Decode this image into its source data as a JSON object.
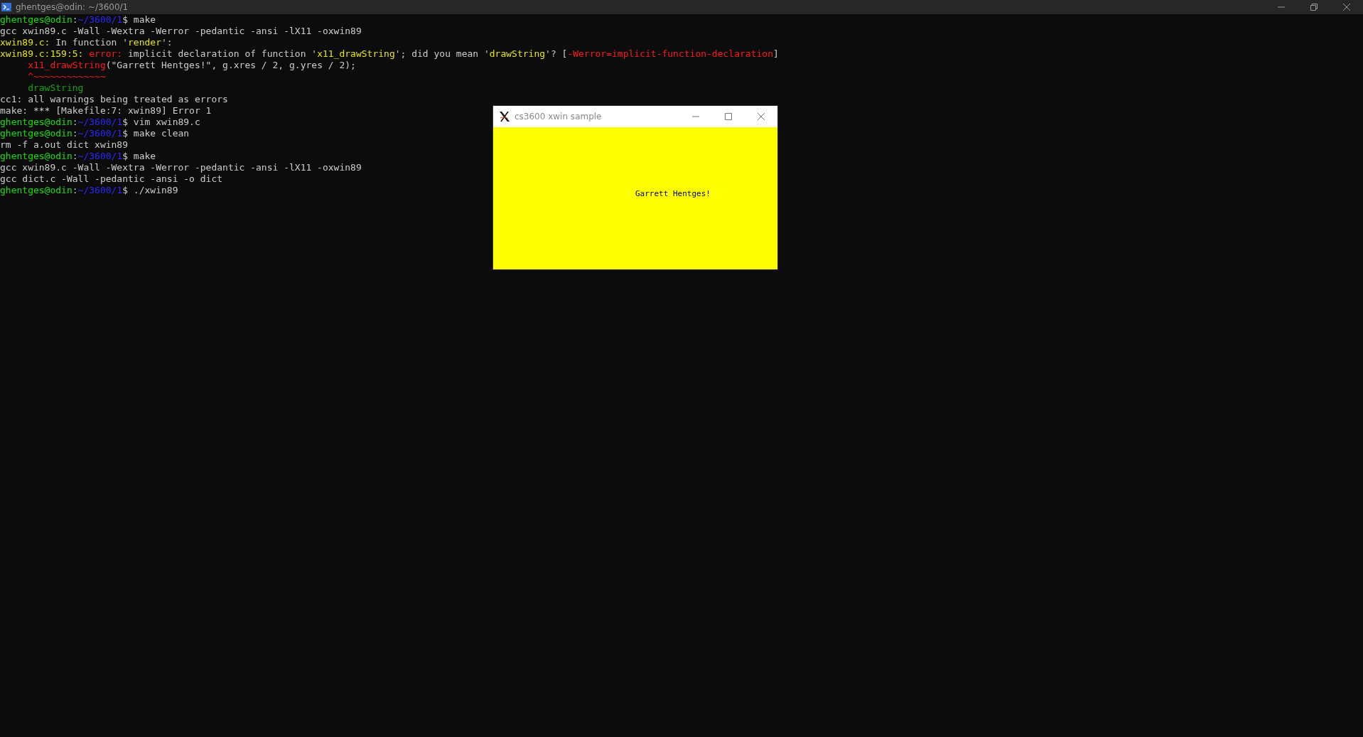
{
  "window": {
    "title": "ghentges@odin: ~/3600/1"
  },
  "terminal": {
    "lines": [
      [
        {
          "text": "ghentges@odin",
          "color": "#16e00c"
        },
        {
          "text": ":"
        },
        {
          "text": "~/3600/1",
          "color": "#2a2aff"
        },
        {
          "text": "$ make"
        }
      ],
      [
        {
          "text": "gcc xwin89.c -Wall -Wextra -Werror -pedantic -ansi -lX11 -oxwin89"
        }
      ],
      [
        {
          "text": "xwin89.c:",
          "color": "#e5e510"
        },
        {
          "text": " In function '"
        },
        {
          "text": "render",
          "color": "#e5e510"
        },
        {
          "text": "':"
        }
      ],
      [
        {
          "text": "xwin89.c:159:5:",
          "color": "#e5e510"
        },
        {
          "text": " error:",
          "color": "#ff1a1a"
        },
        {
          "text": " implicit declaration of function '"
        },
        {
          "text": "x11_drawString",
          "color": "#e5e510"
        },
        {
          "text": "'; did you mean '"
        },
        {
          "text": "drawString",
          "color": "#e5e510"
        },
        {
          "text": "'? ["
        },
        {
          "text": "-Werror=implicit-function-declaration",
          "color": "#ff1a1a"
        },
        {
          "text": "]"
        }
      ],
      [
        {
          "text": "     x11_drawString",
          "color": "#ff1a1a"
        },
        {
          "text": "(\"Garrett Hentges!\", g.xres / 2, g.yres / 2);"
        }
      ],
      [
        {
          "text": "     ^~~~~~~~~~~~~~",
          "color": "#ff1a1a"
        }
      ],
      [
        {
          "text": "     drawString",
          "color": "#13a10e"
        }
      ],
      [
        {
          "text": "cc1: all warnings being treated as errors"
        }
      ],
      [
        {
          "text": "make: *** [Makefile:7: xwin89] Error 1"
        }
      ],
      [
        {
          "text": "ghentges@odin",
          "color": "#16e00c"
        },
        {
          "text": ":"
        },
        {
          "text": "~/3600/1",
          "color": "#2a2aff"
        },
        {
          "text": "$ vim xwin89.c"
        }
      ],
      [
        {
          "text": "ghentges@odin",
          "color": "#16e00c"
        },
        {
          "text": ":"
        },
        {
          "text": "~/3600/1",
          "color": "#2a2aff"
        },
        {
          "text": "$ make clean"
        }
      ],
      [
        {
          "text": "rm -f a.out dict xwin89"
        }
      ],
      [
        {
          "text": "ghentges@odin",
          "color": "#16e00c"
        },
        {
          "text": ":"
        },
        {
          "text": "~/3600/1",
          "color": "#2a2aff"
        },
        {
          "text": "$ make"
        }
      ],
      [
        {
          "text": "gcc xwin89.c -Wall -Wextra -Werror -pedantic -ansi -lX11 -oxwin89"
        }
      ],
      [
        {
          "text": "gcc dict.c -Wall -pedantic -ansi -o dict"
        }
      ],
      [
        {
          "text": "ghentges@odin",
          "color": "#16e00c"
        },
        {
          "text": ":"
        },
        {
          "text": "~/3600/1",
          "color": "#2a2aff"
        },
        {
          "text": "$ ./xwin89"
        }
      ]
    ]
  },
  "x_window": {
    "title": "cs3600 xwin sample",
    "message": "Garrett Hentges!"
  }
}
